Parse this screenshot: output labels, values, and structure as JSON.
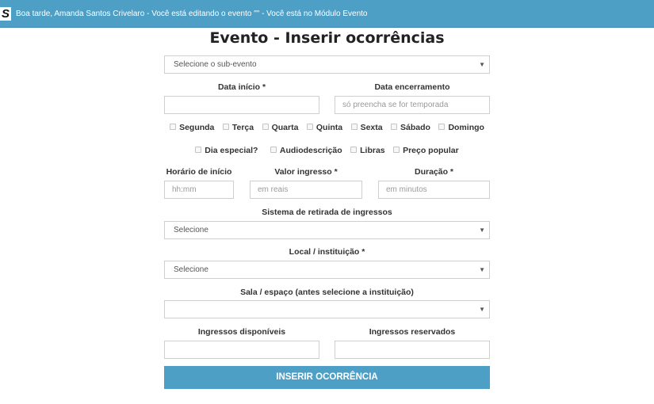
{
  "header": {
    "logo_letter": "S",
    "greeting": "Boa tarde, Amanda Santos Crivelaro - Você está editando o evento \"\" - Você está no Módulo Evento"
  },
  "page": {
    "title": "Evento - Inserir ocorrências"
  },
  "form": {
    "subevent_select": {
      "value": "Selecione o sub-evento"
    },
    "data_inicio": {
      "label": "Data início *",
      "value": "",
      "placeholder": ""
    },
    "data_encerramento": {
      "label": "Data encerramento",
      "value": "",
      "placeholder": "só preencha se for temporada"
    },
    "weekdays": [
      "Segunda",
      "Terça",
      "Quarta",
      "Quinta",
      "Sexta",
      "Sábado",
      "Domingo"
    ],
    "options": [
      "Dia especial?",
      "Audiodescrição",
      "Libras",
      "Preço popular"
    ],
    "horario_inicio": {
      "label": "Horário de início",
      "placeholder": "hh:mm"
    },
    "valor_ingresso": {
      "label": "Valor ingresso *",
      "placeholder": "em reais"
    },
    "duracao": {
      "label": "Duração *",
      "placeholder": "em minutos"
    },
    "sistema_retirada": {
      "label": "Sistema de retirada de ingressos",
      "value": "Selecione"
    },
    "local_instituicao": {
      "label": "Local / instituição *",
      "value": "Selecione"
    },
    "sala_espaco": {
      "label": "Sala / espaço (antes selecione a instituição)",
      "value": ""
    },
    "ingressos_disponiveis": {
      "label": "Ingressos disponíveis",
      "value": ""
    },
    "ingressos_reservados": {
      "label": "Ingressos reservados",
      "value": ""
    },
    "submit_label": "INSERIR OCORRÊNCIA"
  },
  "icons": {
    "select_caret": "caret-down-icon"
  },
  "colors": {
    "accent": "#4d9fc6",
    "border": "#cfcfcf"
  }
}
